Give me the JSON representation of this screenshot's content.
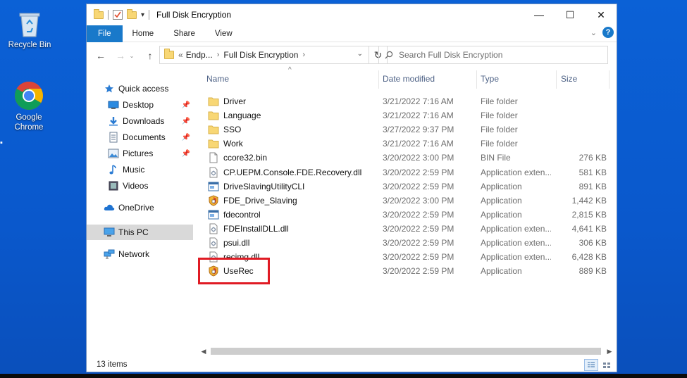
{
  "desktop": {
    "icons": [
      {
        "label": "Recycle Bin",
        "icon": "recycle-bin-icon"
      },
      {
        "label": "Google Chrome",
        "icon": "chrome-icon"
      }
    ]
  },
  "window": {
    "title": "Full Disk Encryption",
    "controls": {
      "minimize": "—",
      "maximize": "☐",
      "close": "✕"
    }
  },
  "ribbon": {
    "tabs": [
      "File",
      "Home",
      "Share",
      "View"
    ],
    "accent": "#1979ca"
  },
  "navigation": {
    "back": "←",
    "forward": "→",
    "up": "↑",
    "address": {
      "prefix": "«",
      "crumbs": [
        "Endp...",
        "Full Disk Encryption"
      ]
    },
    "refresh": "↻",
    "search_placeholder": "Search Full Disk Encryption"
  },
  "sidebar": {
    "items": [
      {
        "label": "Quick access",
        "icon": "star-icon",
        "pinned": false
      },
      {
        "label": "Desktop",
        "icon": "desktop-icon",
        "pinned": true
      },
      {
        "label": "Downloads",
        "icon": "download-icon",
        "pinned": true
      },
      {
        "label": "Documents",
        "icon": "documents-icon",
        "pinned": true
      },
      {
        "label": "Pictures",
        "icon": "pictures-icon",
        "pinned": true
      },
      {
        "label": "Music",
        "icon": "music-icon",
        "pinned": false
      },
      {
        "label": "Videos",
        "icon": "videos-icon",
        "pinned": false
      },
      {
        "label": "OneDrive",
        "icon": "cloud-icon",
        "pinned": false
      },
      {
        "label": "This PC",
        "icon": "computer-icon",
        "pinned": false,
        "selected": true
      },
      {
        "label": "Network",
        "icon": "network-icon",
        "pinned": false
      }
    ]
  },
  "table": {
    "columns": [
      "Name",
      "Date modified",
      "Type",
      "Size"
    ],
    "rows": [
      {
        "name": "Driver",
        "date": "3/21/2022 7:16 AM",
        "type": "File folder",
        "size": "",
        "icon": "folder-icon"
      },
      {
        "name": "Language",
        "date": "3/21/2022 7:16 AM",
        "type": "File folder",
        "size": "",
        "icon": "folder-icon"
      },
      {
        "name": "SSO",
        "date": "3/27/2022 9:37 PM",
        "type": "File folder",
        "size": "",
        "icon": "folder-icon"
      },
      {
        "name": "Work",
        "date": "3/21/2022 7:16 AM",
        "type": "File folder",
        "size": "",
        "icon": "folder-icon"
      },
      {
        "name": "ccore32.bin",
        "date": "3/20/2022 3:00 PM",
        "type": "BIN File",
        "size": "276 KB",
        "icon": "file-icon"
      },
      {
        "name": "CP.UEPM.Console.FDE.Recovery.dll",
        "date": "3/20/2022 2:59 PM",
        "type": "Application exten...",
        "size": "581 KB",
        "icon": "dll-icon"
      },
      {
        "name": "DriveSlavingUtilityCLI",
        "date": "3/20/2022 2:59 PM",
        "type": "Application",
        "size": "891 KB",
        "icon": "app-window-icon"
      },
      {
        "name": "FDE_Drive_Slaving",
        "date": "3/20/2022 3:00 PM",
        "type": "Application",
        "size": "1,442 KB",
        "icon": "app-shield-icon"
      },
      {
        "name": "fdecontrol",
        "date": "3/20/2022 2:59 PM",
        "type": "Application",
        "size": "2,815 KB",
        "icon": "app-window-icon"
      },
      {
        "name": "FDEInstallDLL.dll",
        "date": "3/20/2022 2:59 PM",
        "type": "Application exten...",
        "size": "4,641 KB",
        "icon": "dll-icon"
      },
      {
        "name": "psui.dll",
        "date": "3/20/2022 2:59 PM",
        "type": "Application exten...",
        "size": "306 KB",
        "icon": "dll-icon"
      },
      {
        "name": "recimg.dll",
        "date": "3/20/2022 2:59 PM",
        "type": "Application exten...",
        "size": "6,428 KB",
        "icon": "dll-icon"
      },
      {
        "name": "UseRec",
        "date": "3/20/2022 2:59 PM",
        "type": "Application",
        "size": "889 KB",
        "icon": "app-shield-icon"
      }
    ],
    "highlight_color": "#e01b24"
  },
  "status": {
    "items_count": "13 items"
  }
}
